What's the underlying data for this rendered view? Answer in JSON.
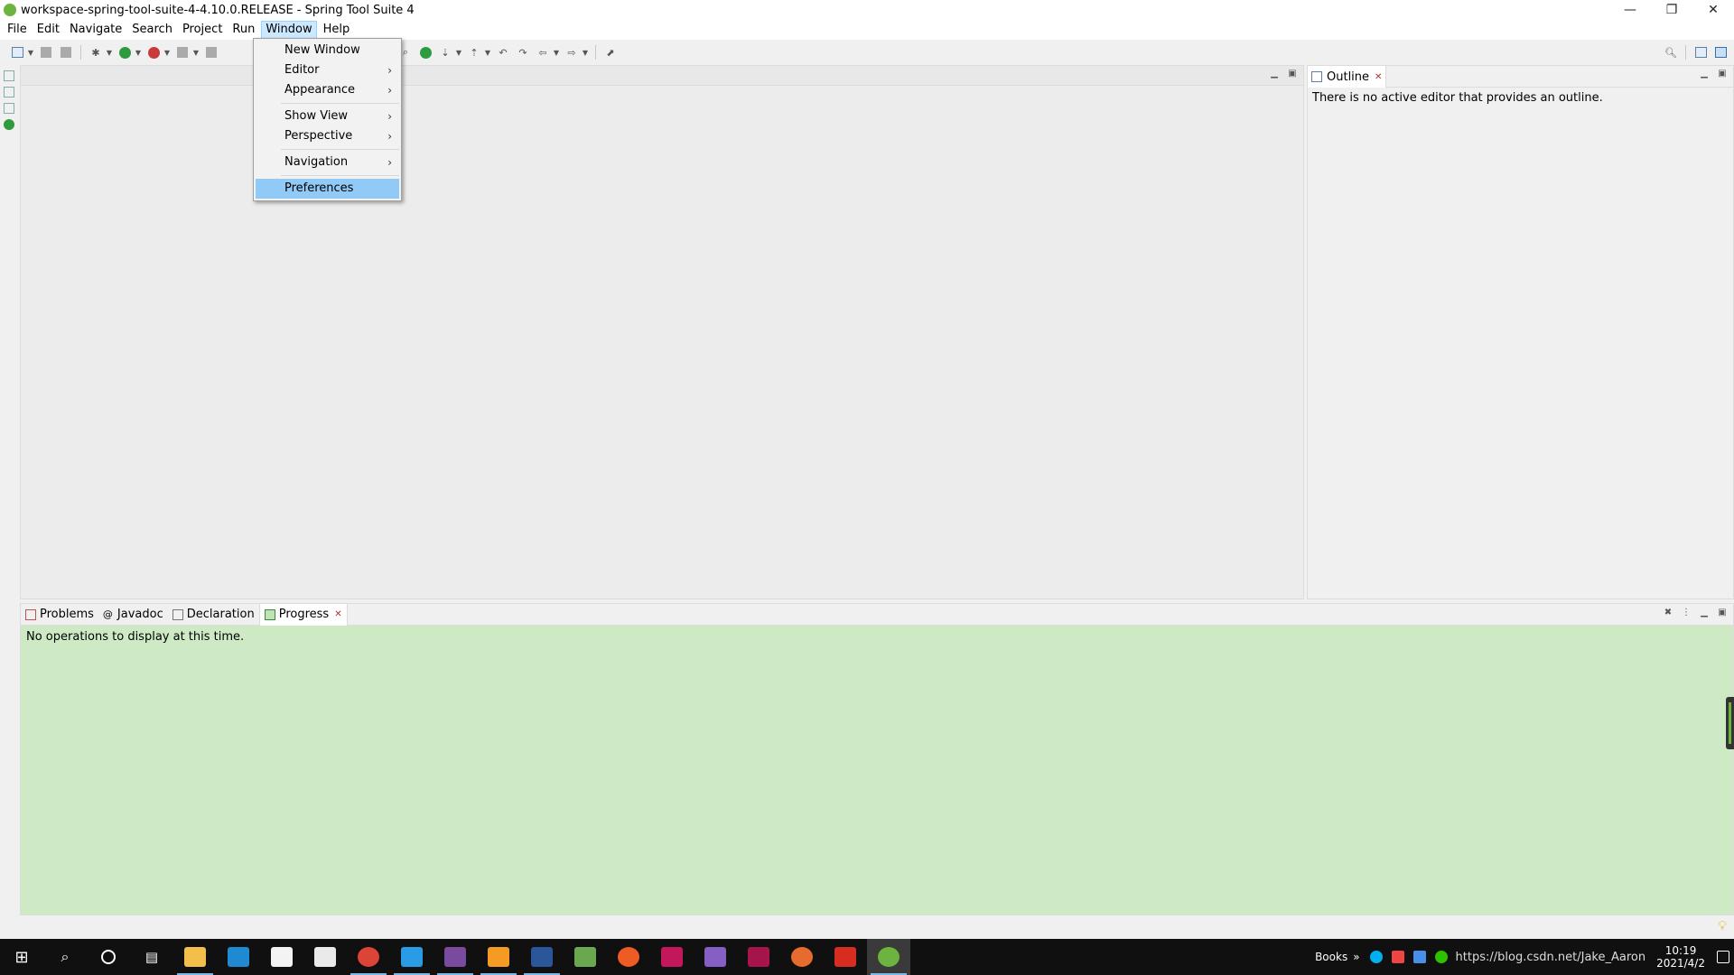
{
  "window": {
    "title": "workspace-spring-tool-suite-4-4.10.0.RELEASE - Spring Tool Suite 4",
    "minimize": "—",
    "restore": "❐",
    "close": "✕"
  },
  "menubar": {
    "items": [
      {
        "label": "File"
      },
      {
        "label": "Edit"
      },
      {
        "label": "Navigate"
      },
      {
        "label": "Search"
      },
      {
        "label": "Project"
      },
      {
        "label": "Run"
      },
      {
        "label": "Window"
      },
      {
        "label": "Help"
      }
    ],
    "active": "Window"
  },
  "window_menu": {
    "items": [
      {
        "label": "New Window",
        "submenu": false
      },
      {
        "label": "Editor",
        "submenu": true
      },
      {
        "label": "Appearance",
        "submenu": true
      },
      {
        "label": "Show View",
        "submenu": true
      },
      {
        "label": "Perspective",
        "submenu": true
      },
      {
        "label": "Navigation",
        "submenu": true
      },
      {
        "label": "Preferences",
        "submenu": false
      }
    ],
    "highlighted": "Preferences",
    "arrow": "›"
  },
  "outline": {
    "tab_label": "Outline",
    "message": "There is no active editor that provides an outline."
  },
  "bottom_panel": {
    "tabs": [
      {
        "label": "Problems"
      },
      {
        "label": "Javadoc"
      },
      {
        "label": "Declaration"
      },
      {
        "label": "Progress"
      }
    ],
    "selected": "Progress",
    "message": "No operations to display at this time."
  },
  "taskbar": {
    "tray_label": "Books",
    "overflow": "»",
    "time": "10:19",
    "date": "2021/4/2",
    "watermark": "https://blog.csdn.net/Jake_Aaron"
  },
  "colors": {
    "progress_bg": "#cdeac5",
    "menu_highlight": "#91c9f7",
    "spring_green": "#6db33f",
    "taskbar": "#101010"
  }
}
